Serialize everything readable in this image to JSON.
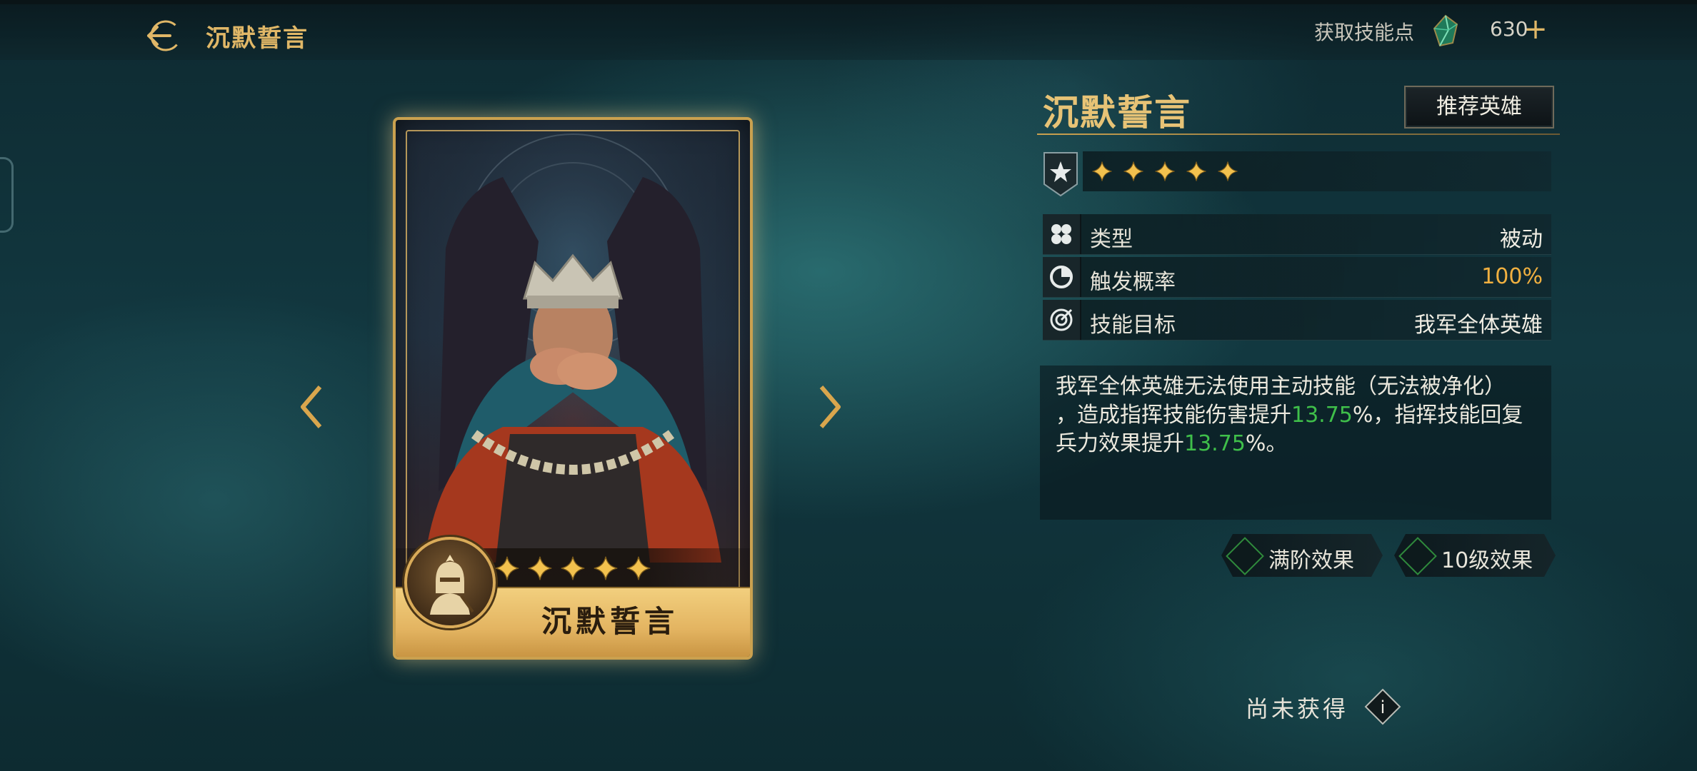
{
  "header": {
    "title": "沉默誓言",
    "points_label": "获取技能点",
    "points_value": "630",
    "plus": "+"
  },
  "card": {
    "name": "沉默誓言",
    "stars": 5
  },
  "skill": {
    "title": "沉默誓言",
    "recommend_label": "推荐英雄",
    "stars": 5,
    "rows": [
      {
        "label": "类型",
        "value": "被动"
      },
      {
        "label": "触发概率",
        "value": "100%"
      },
      {
        "label": "技能目标",
        "value": "我军全体英雄"
      }
    ],
    "description": {
      "part1": "我军全体英雄无法使用主动技能（无法被净化）",
      "part2": "，造成指挥技能伤害提升",
      "value1": "13.75",
      "part3": "%，指挥技能回复兵力效果提升",
      "value2": "13.75",
      "part4": "%。"
    },
    "effect_buttons": [
      {
        "label": "满阶效果"
      },
      {
        "label": "10级效果"
      }
    ],
    "status": "尚未获得",
    "info": "i"
  },
  "colors": {
    "gold": "#e0b767",
    "highlight_green": "#3fbf4a",
    "percent_orange": "#f0b040"
  }
}
